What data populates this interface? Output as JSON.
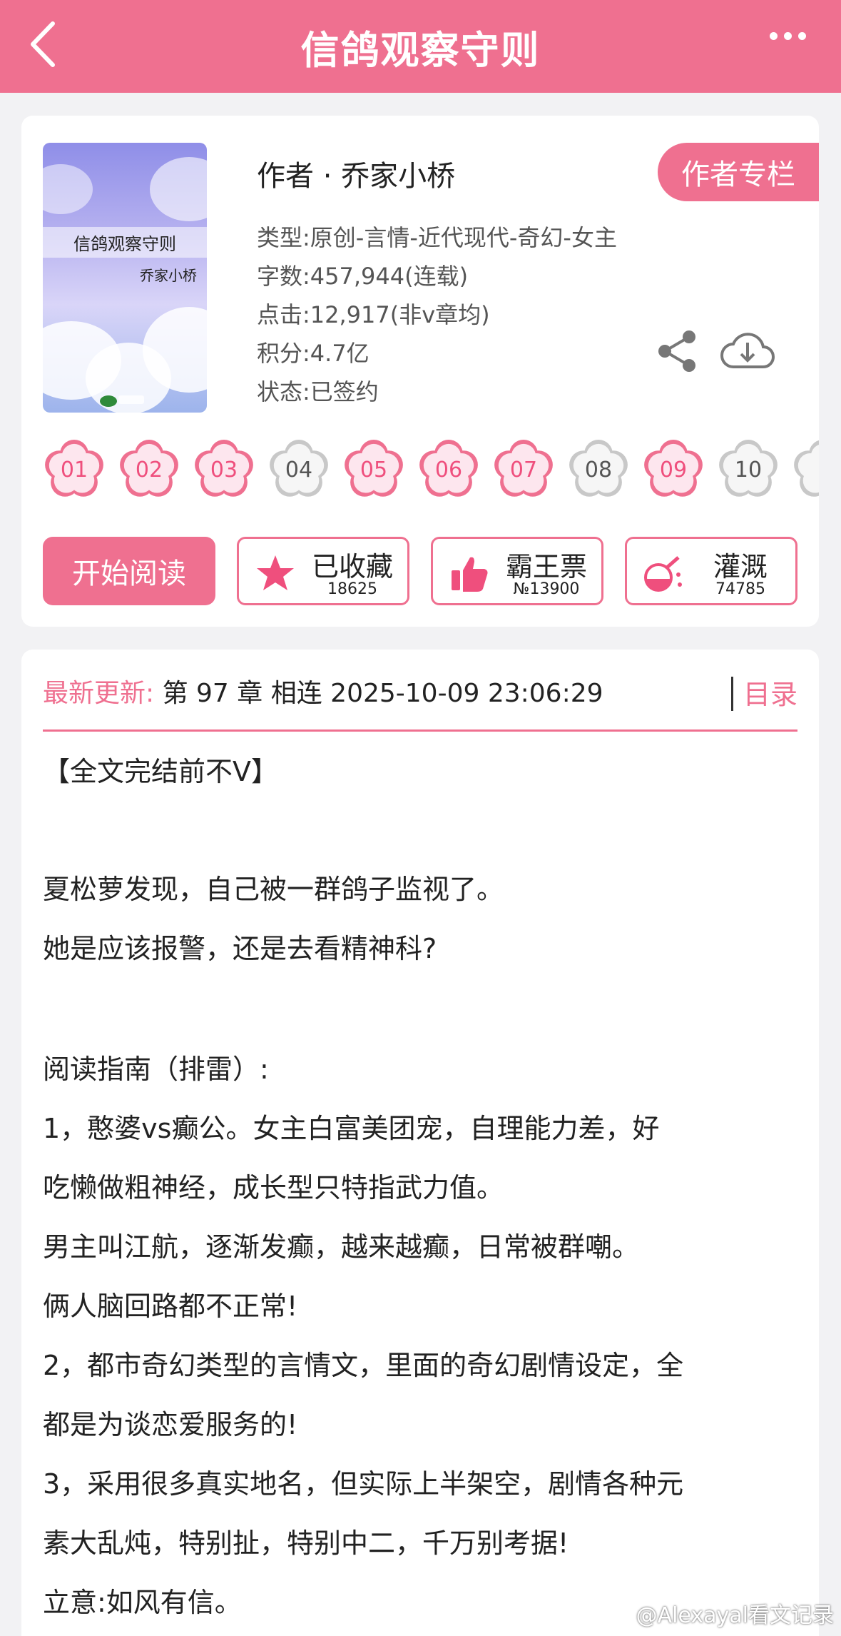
{
  "header": {
    "title": "信鸽观察守则",
    "back_icon": "chevron-left-icon",
    "more_icon": "more-dots-icon",
    "bg_color": "#ef7090"
  },
  "book": {
    "cover_title": "信鸽观察守则",
    "cover_author": "乔家小桥",
    "author_line": "作者 · 乔家小桥",
    "author_column_button": "作者专栏",
    "meta": {
      "type": "类型:原创-言情-近代现代-奇幻-女主",
      "words": "字数:457,944(连载)",
      "clicks": "点击:12,917(非v章均)",
      "points": "积分:4.7亿",
      "status": "状态:已签约"
    }
  },
  "flowers": [
    {
      "num": "01",
      "active": true
    },
    {
      "num": "02",
      "active": true
    },
    {
      "num": "03",
      "active": true
    },
    {
      "num": "04",
      "active": false
    },
    {
      "num": "05",
      "active": true
    },
    {
      "num": "06",
      "active": true
    },
    {
      "num": "07",
      "active": true
    },
    {
      "num": "08",
      "active": false
    },
    {
      "num": "09",
      "active": true
    },
    {
      "num": "10",
      "active": false
    }
  ],
  "actions": {
    "read_label": "开始阅读",
    "collect_label": "已收藏",
    "collect_count": "18625",
    "vote_label": "霸王票",
    "vote_count": "№13900",
    "water_label": "灌溉",
    "water_count": "74785"
  },
  "update": {
    "label": "最新更新:",
    "text": " 第 97 章 相连 2025-10-09 23:06:29",
    "toc": "目录"
  },
  "description": [
    "【全文完结前不V】",
    "夏松萝发现，自己被一群鸽子监视了。",
    "她是应该报警，还是去看精神科?",
    "阅读指南（排雷）:",
    "1，憨婆vs癫公。女主白富美团宠，自理能力差，好",
    "吃懒做粗神经，成长型只特指武力值。",
    "男主叫江航，逐渐发癫，越来越癫，日常被群嘲。",
    "俩人脑回路都不正常!",
    "2，都市奇幻类型的言情文，里面的奇幻剧情设定，全",
    "都是为谈恋爱服务的!",
    "3，采用很多真实地名，但实际上半架空，剧情各种元",
    "素大乱炖，特别扯，特别中二，千万别考据!",
    "立意:如风有信。"
  ],
  "watermark": "@Alexayal看文记录"
}
